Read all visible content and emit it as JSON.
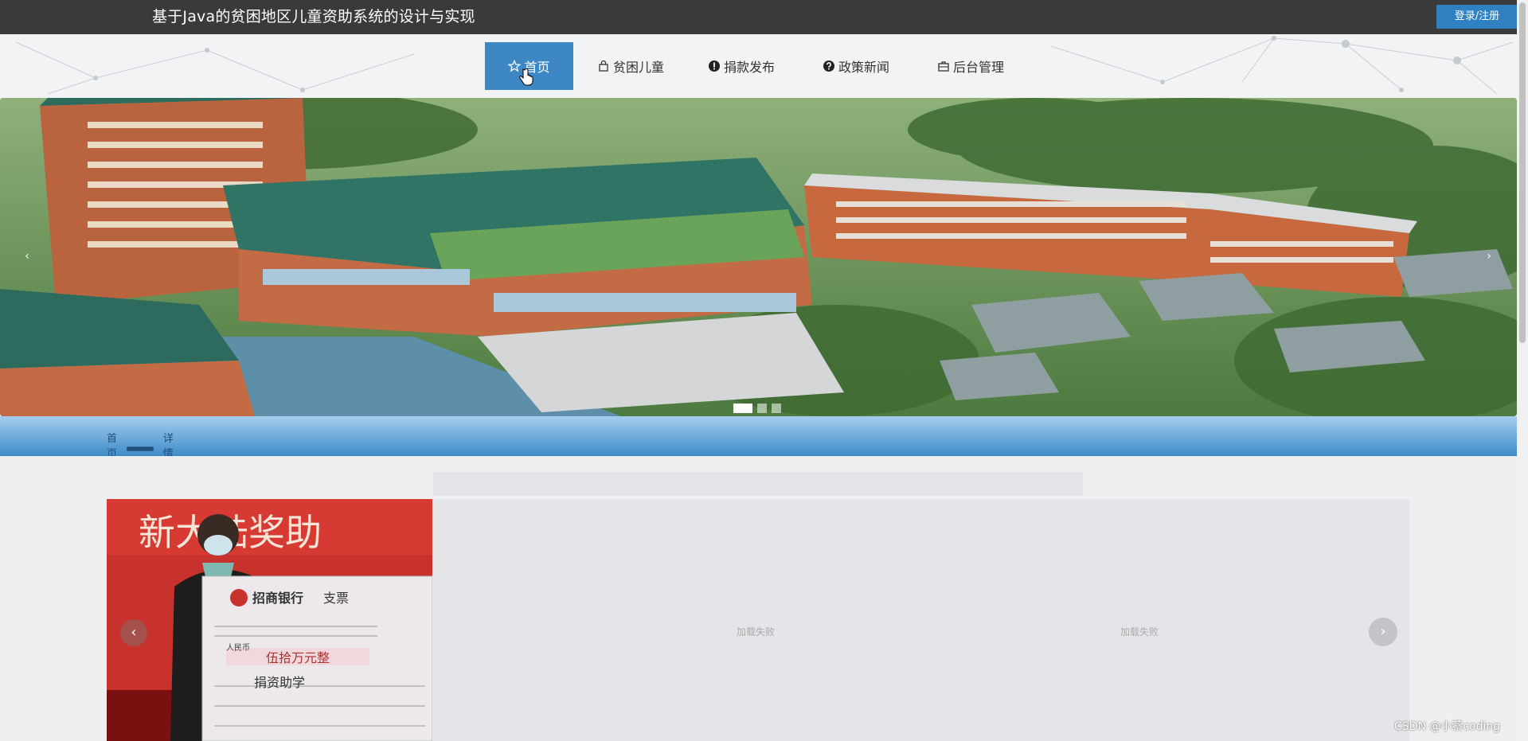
{
  "header": {
    "title": "基于Java的贫困地区儿童资助系统的设计与实现",
    "login_label": "登录/注册"
  },
  "nav": {
    "items": [
      {
        "label": "首页",
        "icon": "star-icon",
        "active": true
      },
      {
        "label": "贫困儿童",
        "icon": "bag-icon"
      },
      {
        "label": "捐款发布",
        "icon": "exclamation-circle-icon"
      },
      {
        "label": "政策新闻",
        "icon": "question-circle-icon"
      },
      {
        "label": "后台管理",
        "icon": "briefcase-icon"
      }
    ]
  },
  "carousel": {
    "prev_symbol": "‹",
    "next_symbol": "›",
    "slide_count": 3,
    "active_index": 0
  },
  "breadcrumb": {
    "home": "首页",
    "current": "详情信息"
  },
  "gallery": {
    "fail_text_1": "加载失败",
    "fail_text_2": "加载失败",
    "prev_symbol": "‹",
    "next_symbol": "›",
    "cheque": {
      "bank": "招商银行",
      "doc_type": "支票",
      "amount_label": "人民币",
      "amount": "伍拾万元整",
      "purpose": "捐资助学",
      "banner_text": "新大陆奖助"
    }
  },
  "watermark": "CSDN @小蔡coding",
  "colors": {
    "topbar": "#3a3a3a",
    "accent": "#3c87c4",
    "login_button": "#2f81c1"
  }
}
